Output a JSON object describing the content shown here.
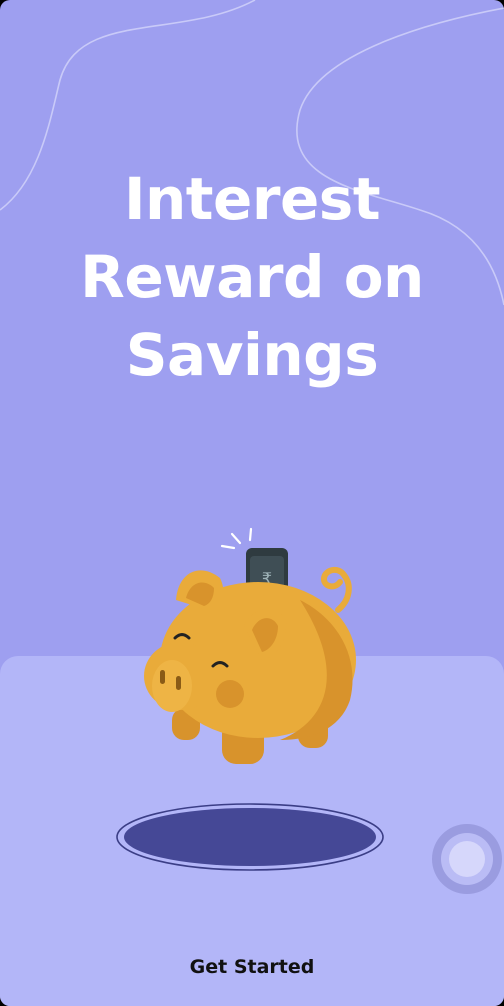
{
  "onboarding": {
    "headline_lines": [
      "Interest",
      "Reward on",
      "Savings"
    ],
    "cta_label": "Get Started"
  },
  "illustration": {
    "subject": "piggy-bank-with-rupee-note",
    "currency_symbol": "₹"
  },
  "icons": {
    "floating_button": "assistive-touch-icon"
  },
  "colors": {
    "background": "#9e9ff0",
    "floor": "#b3b6f8",
    "piggy_body": "#e9ab3a",
    "piggy_shade": "#d8932c",
    "hole": "#454896",
    "text": "#ffffff",
    "cta_text": "#111111"
  }
}
